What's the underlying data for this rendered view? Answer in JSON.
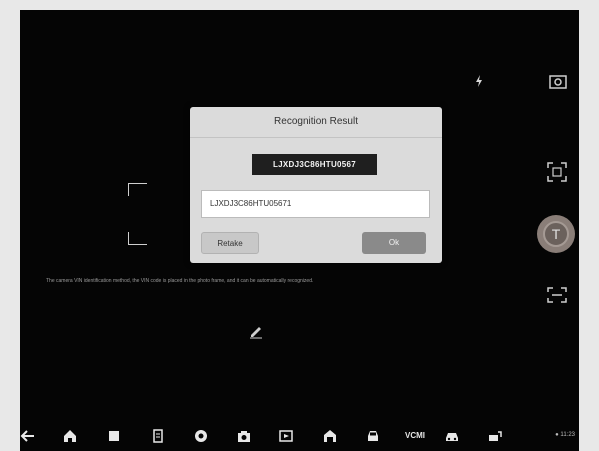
{
  "dialog": {
    "title": "Recognition Result",
    "vin_image_text": "LJXDJ3C86HTU0567",
    "vin_value": "LJXDJ3C86HTU05671",
    "retake_label": "Retake",
    "ok_label": "Ok"
  },
  "camera": {
    "hint": "The camera VIN identification method, the VIN code is placed in the photo frame, and it can be automatically recognized."
  },
  "taskbar": {
    "vcmi_label": "VCMI",
    "status_text": "11:23"
  }
}
